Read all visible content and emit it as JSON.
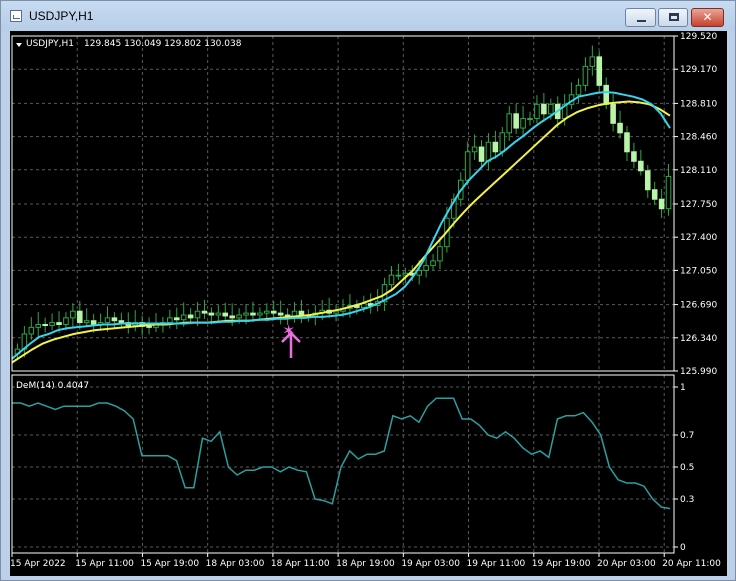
{
  "window": {
    "title": "USDJPY,H1",
    "minimize_icon": "minimize-icon",
    "maximize_icon": "maximize-icon",
    "close_icon": "close-icon",
    "close_glyph": "✕"
  },
  "colors": {
    "background": "#000000",
    "grid": "#5a5a5a",
    "axis_text": "#ffffff",
    "bull_candle": "#b9f4a8",
    "bear_candle": "#b9f4a8",
    "wick": "#2ea844",
    "ma_fast": "#38d3f0",
    "ma_slow": "#f2f24a",
    "demarker": "#2aa0a0",
    "signal": "#e96fe0"
  },
  "main_panel": {
    "symbol_label": "USDJPY,H1",
    "ohlc_label": "129.845 130.049 129.802 130.038",
    "y_ticks": [
      "129.520",
      "129.170",
      "128.810",
      "128.460",
      "128.110",
      "127.750",
      "127.400",
      "127.050",
      "126.690",
      "126.340",
      "125.990"
    ],
    "signal_icon": "star-icon",
    "signal_arrow_icon": "up-arrow-icon"
  },
  "sub_panel": {
    "indicator_label": "DeM(14) 0.4047",
    "y_ticks": [
      "1",
      "0.7",
      "0.5",
      "0.3",
      "0"
    ]
  },
  "x_ticks": [
    "15 Apr 2022",
    "15 Apr 11:00",
    "15 Apr 19:00",
    "18 Apr 03:00",
    "18 Apr 11:00",
    "18 Apr 19:00",
    "19 Apr 03:00",
    "19 Apr 11:00",
    "19 Apr 19:00",
    "20 Apr 03:00",
    "20 Apr 11:00"
  ],
  "chart_data": [
    {
      "type": "candlestick",
      "title": "USDJPY,H1",
      "ylim": [
        125.99,
        129.52
      ],
      "x_categories": [
        "15 Apr 2022",
        "15 Apr 11:00",
        "15 Apr 19:00",
        "18 Apr 03:00",
        "18 Apr 11:00",
        "18 Apr 19:00",
        "19 Apr 03:00",
        "19 Apr 11:00",
        "19 Apr 19:00",
        "20 Apr 03:00",
        "20 Apr 11:00"
      ],
      "close": [
        126.22,
        126.38,
        126.45,
        126.48,
        126.47,
        126.5,
        126.48,
        126.55,
        126.62,
        126.5,
        126.52,
        126.48,
        126.5,
        126.55,
        126.52,
        126.5,
        126.47,
        126.5,
        126.46,
        126.45,
        126.48,
        126.5,
        126.55,
        126.53,
        126.58,
        126.55,
        126.62,
        126.6,
        126.58,
        126.6,
        126.57,
        126.55,
        126.58,
        126.6,
        126.58,
        126.6,
        126.62,
        126.6,
        126.58,
        126.55,
        126.62,
        126.58,
        126.57,
        126.6,
        126.63,
        126.6,
        126.62,
        126.65,
        126.68,
        126.66,
        126.7,
        126.68,
        126.72,
        126.9,
        127.0,
        127.0,
        127.02,
        127.0,
        127.05,
        127.1,
        127.15,
        127.3,
        127.6,
        127.8,
        128.0,
        128.3,
        128.35,
        128.2,
        128.4,
        128.3,
        128.5,
        128.7,
        128.55,
        128.65,
        128.65,
        128.8,
        128.7,
        128.8,
        128.65,
        128.8,
        128.9,
        129.0,
        129.2,
        129.3,
        129.0,
        128.8,
        128.6,
        128.5,
        128.3,
        128.2,
        128.1,
        127.9,
        127.8,
        127.7,
        128.04
      ],
      "ma_fast": [
        126.12,
        126.2,
        126.28,
        126.35,
        126.38,
        126.42,
        126.44,
        126.45,
        126.46,
        126.47,
        126.48,
        126.48,
        126.49,
        126.49,
        126.49,
        126.49,
        126.49,
        126.49,
        126.49,
        126.49,
        126.5,
        126.5,
        126.5,
        126.51,
        126.51,
        126.52,
        126.52,
        126.53,
        126.53,
        126.54,
        126.54,
        126.55,
        126.55,
        126.56,
        126.56,
        126.57,
        126.58,
        126.6,
        126.63,
        126.66,
        126.7,
        126.75,
        126.8,
        126.88,
        127.0,
        127.15,
        127.35,
        127.55,
        127.72,
        127.88,
        128.0,
        128.1,
        128.2,
        128.25,
        128.32,
        128.4,
        128.47,
        128.55,
        128.62,
        128.68,
        128.75,
        128.82,
        128.88,
        128.9,
        128.92,
        128.93,
        128.92,
        128.9,
        128.88,
        128.85,
        128.8,
        128.7,
        128.55
      ],
      "ma_slow": [
        126.08,
        126.15,
        126.22,
        126.28,
        126.32,
        126.35,
        126.38,
        126.4,
        126.42,
        126.43,
        126.44,
        126.45,
        126.46,
        126.47,
        126.48,
        126.48,
        126.49,
        126.5,
        126.5,
        126.5,
        126.51,
        126.52,
        126.52,
        126.52,
        126.53,
        126.54,
        126.55,
        126.56,
        126.57,
        126.58,
        126.6,
        126.62,
        126.64,
        126.67,
        126.7,
        126.74,
        126.78,
        126.85,
        126.95,
        127.05,
        127.18,
        127.3,
        127.42,
        127.55,
        127.67,
        127.78,
        127.88,
        127.98,
        128.08,
        128.18,
        128.28,
        128.38,
        128.48,
        128.58,
        128.66,
        128.72,
        128.76,
        128.79,
        128.81,
        128.82,
        128.83,
        128.82,
        128.8,
        128.75,
        128.68
      ]
    },
    {
      "type": "line",
      "title": "DeM(14) 0.4047",
      "ylim": [
        0,
        1
      ],
      "series": [
        {
          "name": "DeM(14)",
          "values": [
            0.9,
            0.9,
            0.88,
            0.9,
            0.88,
            0.86,
            0.88,
            0.88,
            0.88,
            0.88,
            0.9,
            0.9,
            0.88,
            0.85,
            0.8,
            0.57,
            0.57,
            0.57,
            0.57,
            0.54,
            0.37,
            0.37,
            0.68,
            0.66,
            0.72,
            0.5,
            0.45,
            0.48,
            0.48,
            0.5,
            0.5,
            0.47,
            0.5,
            0.48,
            0.47,
            0.3,
            0.29,
            0.27,
            0.5,
            0.6,
            0.55,
            0.58,
            0.58,
            0.6,
            0.82,
            0.8,
            0.82,
            0.78,
            0.88,
            0.93,
            0.93,
            0.93,
            0.8,
            0.8,
            0.76,
            0.7,
            0.68,
            0.72,
            0.68,
            0.62,
            0.58,
            0.6,
            0.56,
            0.8,
            0.82,
            0.82,
            0.84,
            0.78,
            0.7,
            0.5,
            0.42,
            0.4,
            0.4,
            0.38,
            0.3,
            0.25,
            0.24
          ]
        }
      ]
    }
  ]
}
